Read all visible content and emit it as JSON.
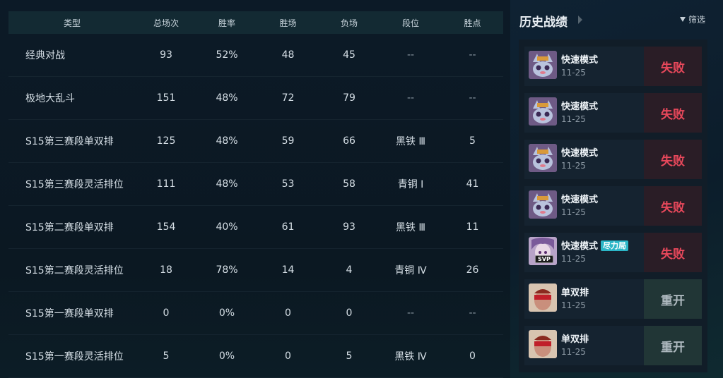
{
  "table": {
    "headers": [
      "类型",
      "总场次",
      "胜率",
      "胜场",
      "负场",
      "段位",
      "胜点"
    ],
    "rows": [
      {
        "type": "经典对战",
        "total": "93",
        "winrate": "52%",
        "wins": "48",
        "losses": "45",
        "rank": "--",
        "lp": "--"
      },
      {
        "type": "极地大乱斗",
        "total": "151",
        "winrate": "48%",
        "wins": "72",
        "losses": "79",
        "rank": "--",
        "lp": "--"
      },
      {
        "type": "S15第三赛段单双排",
        "total": "125",
        "winrate": "48%",
        "wins": "59",
        "losses": "66",
        "rank": "黑铁 Ⅲ",
        "lp": "5"
      },
      {
        "type": "S15第三赛段灵活排位",
        "total": "111",
        "winrate": "48%",
        "wins": "53",
        "losses": "58",
        "rank": "青铜 Ⅰ",
        "lp": "41"
      },
      {
        "type": "S15第二赛段单双排",
        "total": "154",
        "winrate": "40%",
        "wins": "61",
        "losses": "93",
        "rank": "黑铁 Ⅲ",
        "lp": "11"
      },
      {
        "type": "S15第二赛段灵活排位",
        "total": "18",
        "winrate": "78%",
        "wins": "14",
        "losses": "4",
        "rank": "青铜 Ⅳ",
        "lp": "26"
      },
      {
        "type": "S15第一赛段单双排",
        "total": "0",
        "winrate": "0%",
        "wins": "0",
        "losses": "0",
        "rank": "--",
        "lp": "--"
      },
      {
        "type": "S15第一赛段灵活排位",
        "total": "5",
        "winrate": "0%",
        "wins": "0",
        "losses": "5",
        "rank": "黑铁 Ⅳ",
        "lp": "0"
      }
    ]
  },
  "history": {
    "title": "历史战绩",
    "filter_label": "筛选",
    "filter_icon": "filter-icon",
    "matches": [
      {
        "mode": "快速模式",
        "date": "11-25",
        "result": "失败",
        "outcome": "lose",
        "champion_icon": "cat-champion-avatar"
      },
      {
        "mode": "快速模式",
        "date": "11-25",
        "result": "失败",
        "outcome": "lose",
        "champion_icon": "cat-champion-avatar"
      },
      {
        "mode": "快速模式",
        "date": "11-25",
        "result": "失败",
        "outcome": "lose",
        "champion_icon": "cat-champion-avatar"
      },
      {
        "mode": "快速模式",
        "date": "11-25",
        "result": "失败",
        "outcome": "lose",
        "champion_icon": "cat-champion-avatar"
      },
      {
        "mode": "快速模式",
        "date": "11-25",
        "result": "失败",
        "outcome": "lose",
        "badge": "尽力局",
        "svp": "SVP",
        "champion_icon": "purple-champion-avatar"
      },
      {
        "mode": "单双排",
        "date": "11-25",
        "result": "重开",
        "outcome": "remake",
        "champion_icon": "red-champion-avatar"
      },
      {
        "mode": "单双排",
        "date": "11-25",
        "result": "重开",
        "outcome": "remake",
        "champion_icon": "red-champion-avatar"
      }
    ]
  },
  "colors": {
    "lose": "#e8485b",
    "remake": "#aeb9bf",
    "badge": "#2bb6c7"
  }
}
